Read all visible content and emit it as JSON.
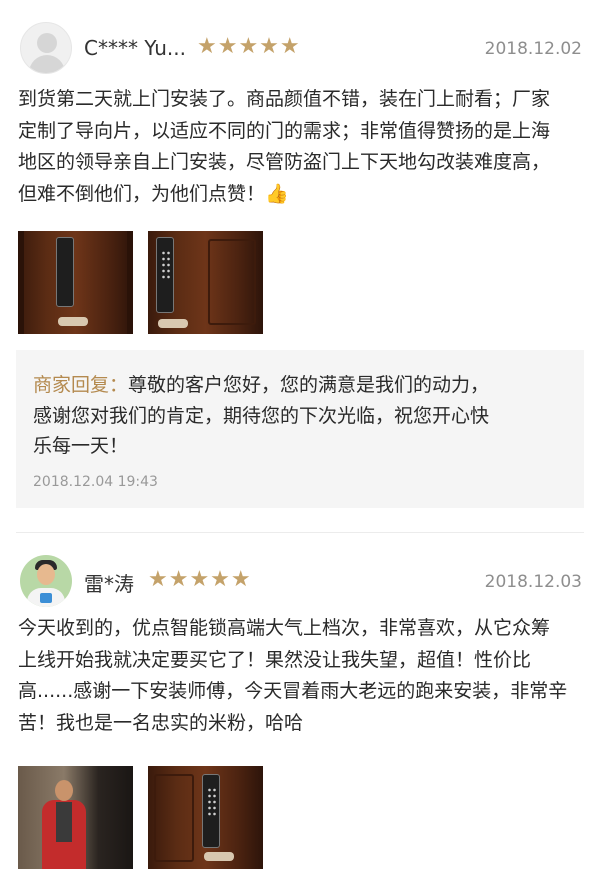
{
  "reviews": [
    {
      "user_name": "C**** Yu...",
      "stars": "★★★★★",
      "date": "2018.12.02",
      "lines": [
        "到货第二天就上门安装了。商品颜值不错，装在门上耐看；厂家",
        "定制了导向片，以适应不同的门的需求；非常值得赞扬的是上海",
        "地区的领导亲自上门安装，尽管防盗门上下天地勾改装难度高，",
        "但难不倒他们，为他们点赞！👍"
      ],
      "photos": [
        "smart-lock-door-photo",
        "smart-lock-keypad-photo"
      ],
      "reply": {
        "label": "商家回复：",
        "lines": [
          "尊敬的客户您好，您的满意是我们的动力，",
          "感谢您对我们的肯定，期待您的下次光临，祝您开心快",
          "乐每一天！"
        ],
        "time": "2018.12.04 19:43"
      }
    },
    {
      "user_name": "雷*涛",
      "stars": "★★★★★",
      "date": "2018.12.03",
      "lines": [
        "今天收到的，优点智能锁高端大气上档次，非常喜欢，从它众筹",
        "上线开始我就决定要买它了！果然没让我失望，超值！性价比",
        "高......感谢一下安装师傅，今天冒着雨大老远的跑来安装，非常辛",
        "苦！我也是一名忠实的米粉，哈哈"
      ],
      "photos": [
        "installer-photo",
        "installed-lock-photo"
      ]
    }
  ],
  "colors": {
    "star": "#c4a26a",
    "reply_label": "#b48a4f",
    "reply_bg": "#f5f5f5",
    "date": "#8e8e8e"
  }
}
